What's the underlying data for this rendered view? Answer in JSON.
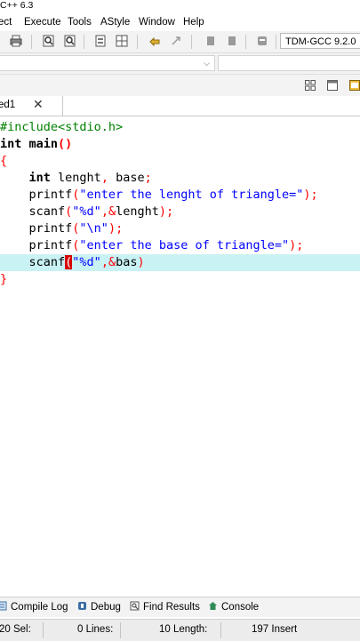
{
  "window": {
    "title": "C++ 6.3"
  },
  "menu": {
    "items": [
      "ect",
      "Execute",
      "Tools",
      "AStyle",
      "Window",
      "Help"
    ]
  },
  "toolbar": {
    "compiler": "TDM-GCC 9.2.0"
  },
  "tabs": {
    "file_label": "ed1",
    "close_glyph": "✕"
  },
  "editor": {
    "lines": [
      "#include<stdio.h>",
      "int main()",
      "{",
      "    int lenght, base;",
      "    printf(\"enter the lenght of triangle=\");",
      "    scanf(\"%d\",&lenght);",
      "    printf(\"\\n\");",
      "    printf(\"enter the base of triangle=\");",
      "    scanf(\"%d\",&bas)",
      "}"
    ],
    "highlighted_line_index": 8
  },
  "bottom_tabs": [
    "Compile Log",
    "Debug",
    "Find Results",
    "Console"
  ],
  "status": {
    "sel": "20 Sel:",
    "lines": "0 Lines:",
    "length": "10 Length:",
    "mode": "197 Insert"
  },
  "colors": {
    "keyword": "#000000",
    "string": "#0000ff",
    "preprocessor": "#008000",
    "symbol": "#ff0000",
    "line_highlight": "#c9f2f5"
  }
}
